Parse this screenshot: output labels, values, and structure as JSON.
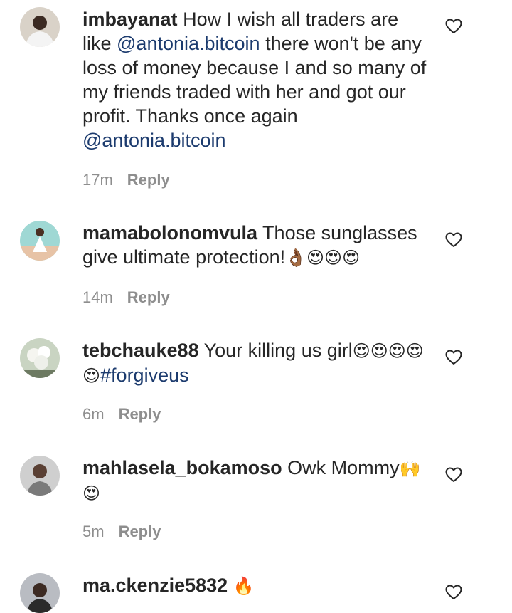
{
  "comments": [
    {
      "username": "imbayanat",
      "text_1": " How I wish all traders are like ",
      "mention_1": "@antonia.bitcoin",
      "text_2": " there won't be any loss of money because I and so many of my friends traded with her and got our profit. Thanks once again ",
      "mention_2": "@antonia.bitcoin",
      "time": "17m",
      "reply_label": "Reply"
    },
    {
      "username": "mamabolonomvula",
      "text": " Those sunglasses give ultimate protection!",
      "emoji": "👌🏾😍😍😍",
      "time": "14m",
      "reply_label": "Reply"
    },
    {
      "username": "tebchauke88",
      "text": " Your killing us girl",
      "emoji": "😍😍😍😍😍",
      "hashtag": "#forgiveus",
      "time": "6m",
      "reply_label": "Reply"
    },
    {
      "username": "mahlasela_bokamoso",
      "text": " Owk Mommy",
      "emoji": "🙌😍",
      "time": "5m",
      "reply_label": "Reply"
    },
    {
      "username": "ma.ckenzie5832",
      "emoji": "🔥"
    }
  ],
  "icons": {
    "like": "heart-outline-icon"
  },
  "colors": {
    "text": "#262626",
    "mention": "#1c3b6e",
    "meta": "#8e8e8e"
  }
}
